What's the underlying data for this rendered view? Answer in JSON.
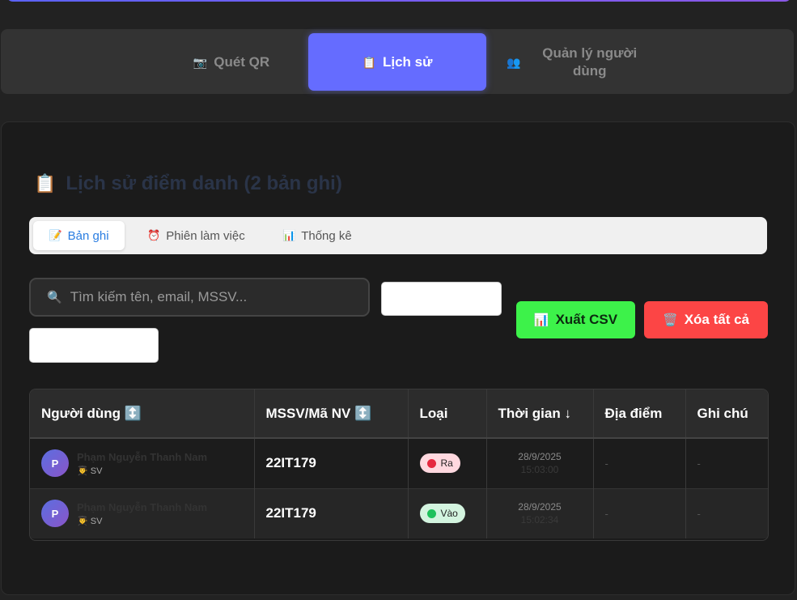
{
  "nav": {
    "tabs": [
      {
        "icon": "📷",
        "label": "Quét QR"
      },
      {
        "icon": "📋",
        "label": "Lịch sử"
      },
      {
        "icon": "👥",
        "label": "Quản lý người dùng"
      }
    ],
    "active": "Lịch sử"
  },
  "history": {
    "title_icon": "📋",
    "title": "Lịch sử điểm danh (2 bản ghi)",
    "subtabs": [
      {
        "icon": "📝",
        "label": "Bản ghi"
      },
      {
        "icon": "⏰",
        "label": "Phiên làm việc"
      },
      {
        "icon": "📊",
        "label": "Thống kê"
      }
    ],
    "search": {
      "icon": "🔍",
      "placeholder": "Tìm kiếm tên, email, MSSV..."
    },
    "export_button": {
      "icon": "📊",
      "label": "Xuất CSV"
    },
    "clear_button": {
      "icon": "🗑️",
      "label": "Xóa tất cả"
    },
    "columns": [
      "Người dùng ↕️",
      "MSSV/Mã NV ↕️",
      "Loại",
      "Thời gian ↓",
      "Địa điểm",
      "Ghi chú"
    ],
    "rows": [
      {
        "avatar": "P",
        "name": "Phạm Nguyễn Thanh Nam",
        "role_icon": "👨‍🎓",
        "role": "SV",
        "mssv": "22IT179",
        "type": "Ra",
        "date": "28/9/2025",
        "time": "15:03:00",
        "location": "-",
        "note": "-"
      },
      {
        "avatar": "P",
        "name": "Phạm Nguyễn Thanh Nam",
        "role_icon": "👨‍🎓",
        "role": "SV",
        "mssv": "22IT179",
        "type": "Vào",
        "date": "28/9/2025",
        "time": "15:02:34",
        "location": "-",
        "note": "-"
      }
    ]
  },
  "colors": {
    "accent": "#656cff",
    "export": "#3df24a",
    "clear": "#fc4545",
    "badge_out": "#e5283f",
    "badge_in": "#1fc15c"
  }
}
